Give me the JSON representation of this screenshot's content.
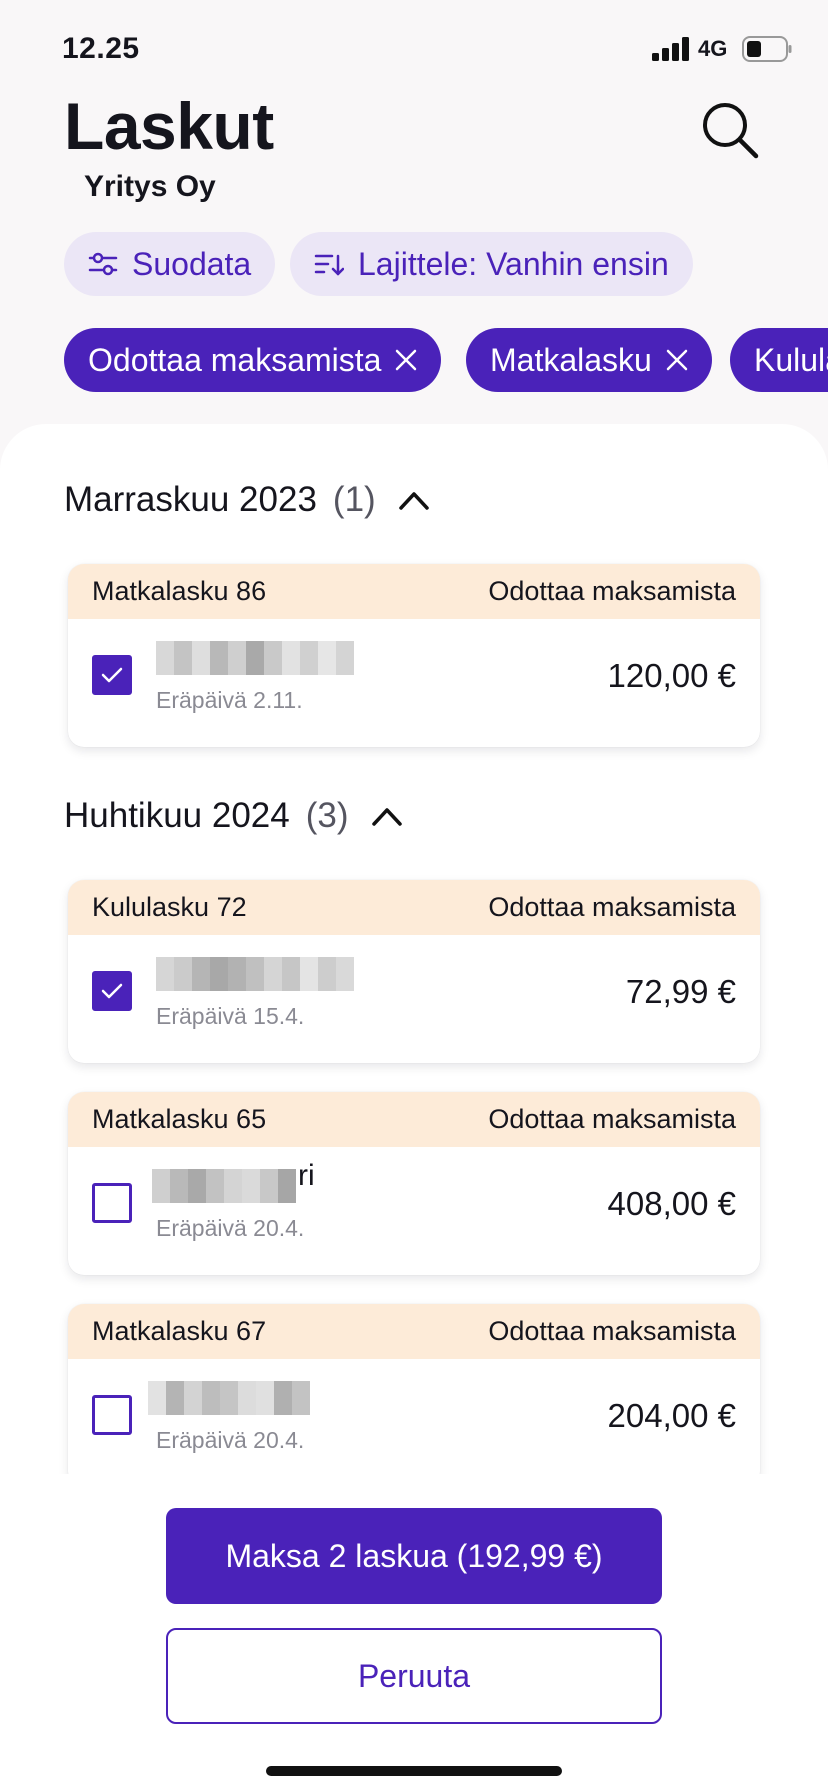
{
  "status_bar": {
    "time": "12.25",
    "network": "4G"
  },
  "header": {
    "title": "Laskut",
    "company": "Yritys Oy",
    "search_icon": "search-icon"
  },
  "filters": {
    "filter_label": "Suodata",
    "sort_label": "Lajittele: Vanhin ensin",
    "chips": [
      "Odottaa maksamista",
      "Matkalasku",
      "Kulula"
    ]
  },
  "groups": [
    {
      "month": "Marraskuu 2023",
      "count": "(1)"
    },
    {
      "month": "Huhtikuu 2024",
      "count": "(3)"
    }
  ],
  "invoices": [
    {
      "title": "Matkalasku 86",
      "status": "Odottaa maksamista",
      "name_tail": "",
      "due": "Eräpäivä 2.11.",
      "amount": "120,00 €",
      "checked": true
    },
    {
      "title": "Kululasku 72",
      "status": "Odottaa maksamista",
      "name_tail": "",
      "due": "Eräpäivä 15.4.",
      "amount": "72,99 €",
      "checked": true
    },
    {
      "title": "Matkalasku 65",
      "status": "Odottaa maksamista",
      "name_tail": "ri",
      "due": "Eräpäivä 20.4.",
      "amount": "408,00 €",
      "checked": false
    },
    {
      "title": "Matkalasku 67",
      "status": "Odottaa maksamista",
      "name_tail": "",
      "due": "Eräpäivä 20.4.",
      "amount": "204,00 €",
      "checked": false
    }
  ],
  "actions": {
    "pay": "Maksa 2 laskua (192,99 €)",
    "cancel": "Peruuta"
  },
  "colors": {
    "accent": "#4a22b9",
    "card_header": "#fdebd8",
    "pill_light": "#ebe6f6"
  }
}
